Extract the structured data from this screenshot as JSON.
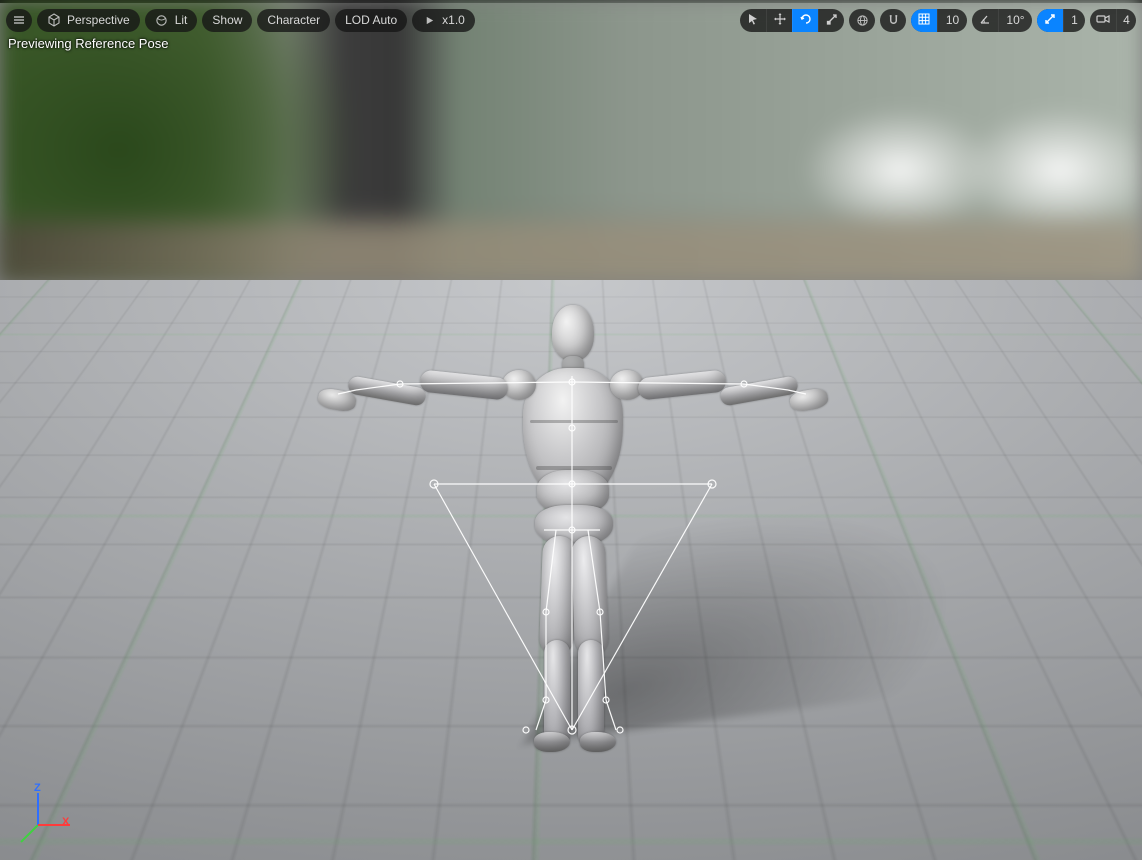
{
  "toolbar": {
    "left": {
      "menu_icon": "hamburger-icon",
      "perspective_label": "Perspective",
      "lit_label": "Lit",
      "show_label": "Show",
      "character_label": "Character",
      "lod_label": "LOD Auto",
      "speed_label": "x1.0"
    },
    "right": {
      "grid_value": "10",
      "rotation_value": "10°",
      "scale_value": "1",
      "camera_value": "4"
    }
  },
  "overlay": {
    "status_text": "Previewing Reference Pose"
  },
  "gizmo": {
    "x_label": "X",
    "z_label": "Z",
    "colors": {
      "x": "#ff3b3b",
      "y": "#3fd23f",
      "z": "#2f6fff"
    }
  }
}
